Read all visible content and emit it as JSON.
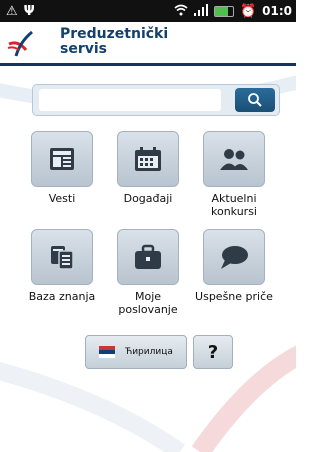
{
  "status_bar": {
    "time": "01:0"
  },
  "app": {
    "title": "Preduzetnički\nservis"
  },
  "search": {
    "placeholder": "",
    "value": ""
  },
  "tiles": [
    {
      "label": "Vesti",
      "icon": "newspaper-icon"
    },
    {
      "label": "Događaji",
      "icon": "calendar-icon"
    },
    {
      "label": "Aktuelni\nkonkursi",
      "icon": "people-icon"
    },
    {
      "label": "Baza znanja",
      "icon": "documents-icon"
    },
    {
      "label": "Moje\nposlovanje",
      "icon": "briefcase-icon"
    },
    {
      "label": "Uspešne priče",
      "icon": "speech-bubble-icon"
    }
  ],
  "language_button": {
    "label": "Ћирилица"
  },
  "help_button": {
    "label": "?"
  },
  "colors": {
    "brand_blue": "#14406d",
    "accent_red": "#e2202a",
    "search_button": "#1b4f76"
  }
}
